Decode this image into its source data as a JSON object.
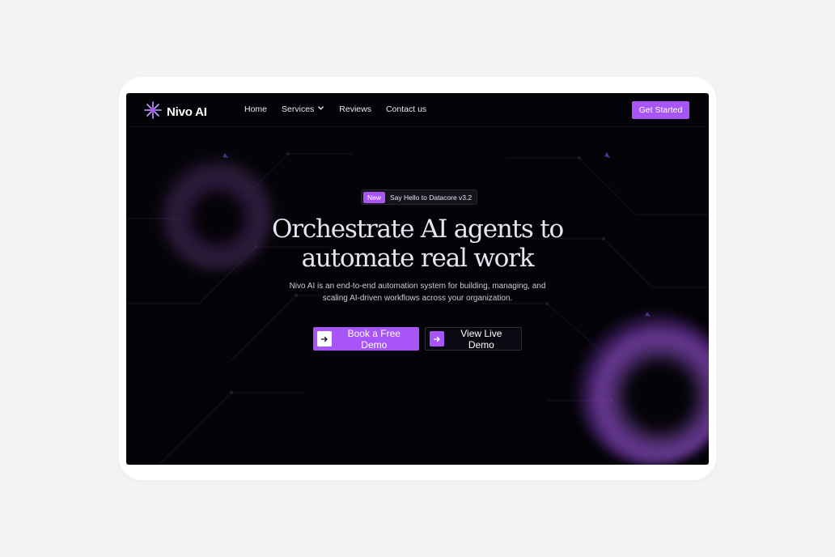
{
  "brand": {
    "name": "Nivo AI",
    "accent": "#a855f7"
  },
  "nav": {
    "items": [
      {
        "label": "Home"
      },
      {
        "label": "Services",
        "icon": "chevron-down-icon"
      },
      {
        "label": "Reviews"
      },
      {
        "label": "Contact us"
      }
    ],
    "cta_label": "Get Started"
  },
  "hero": {
    "badge_tag": "New",
    "badge_text": "Say Hello to Datacore v3.2",
    "headline_line1": "Orchestrate AI agents to",
    "headline_line2": "automate real work",
    "subtitle_line1": "Nivo AI is an end-to-end automation system for building, managing, and",
    "subtitle_line2": "scaling AI-driven workflows across your organization.",
    "primary_button": "Book a Free Demo",
    "secondary_button": "View Live Demo",
    "button_icon": "arrow-right-icon"
  }
}
